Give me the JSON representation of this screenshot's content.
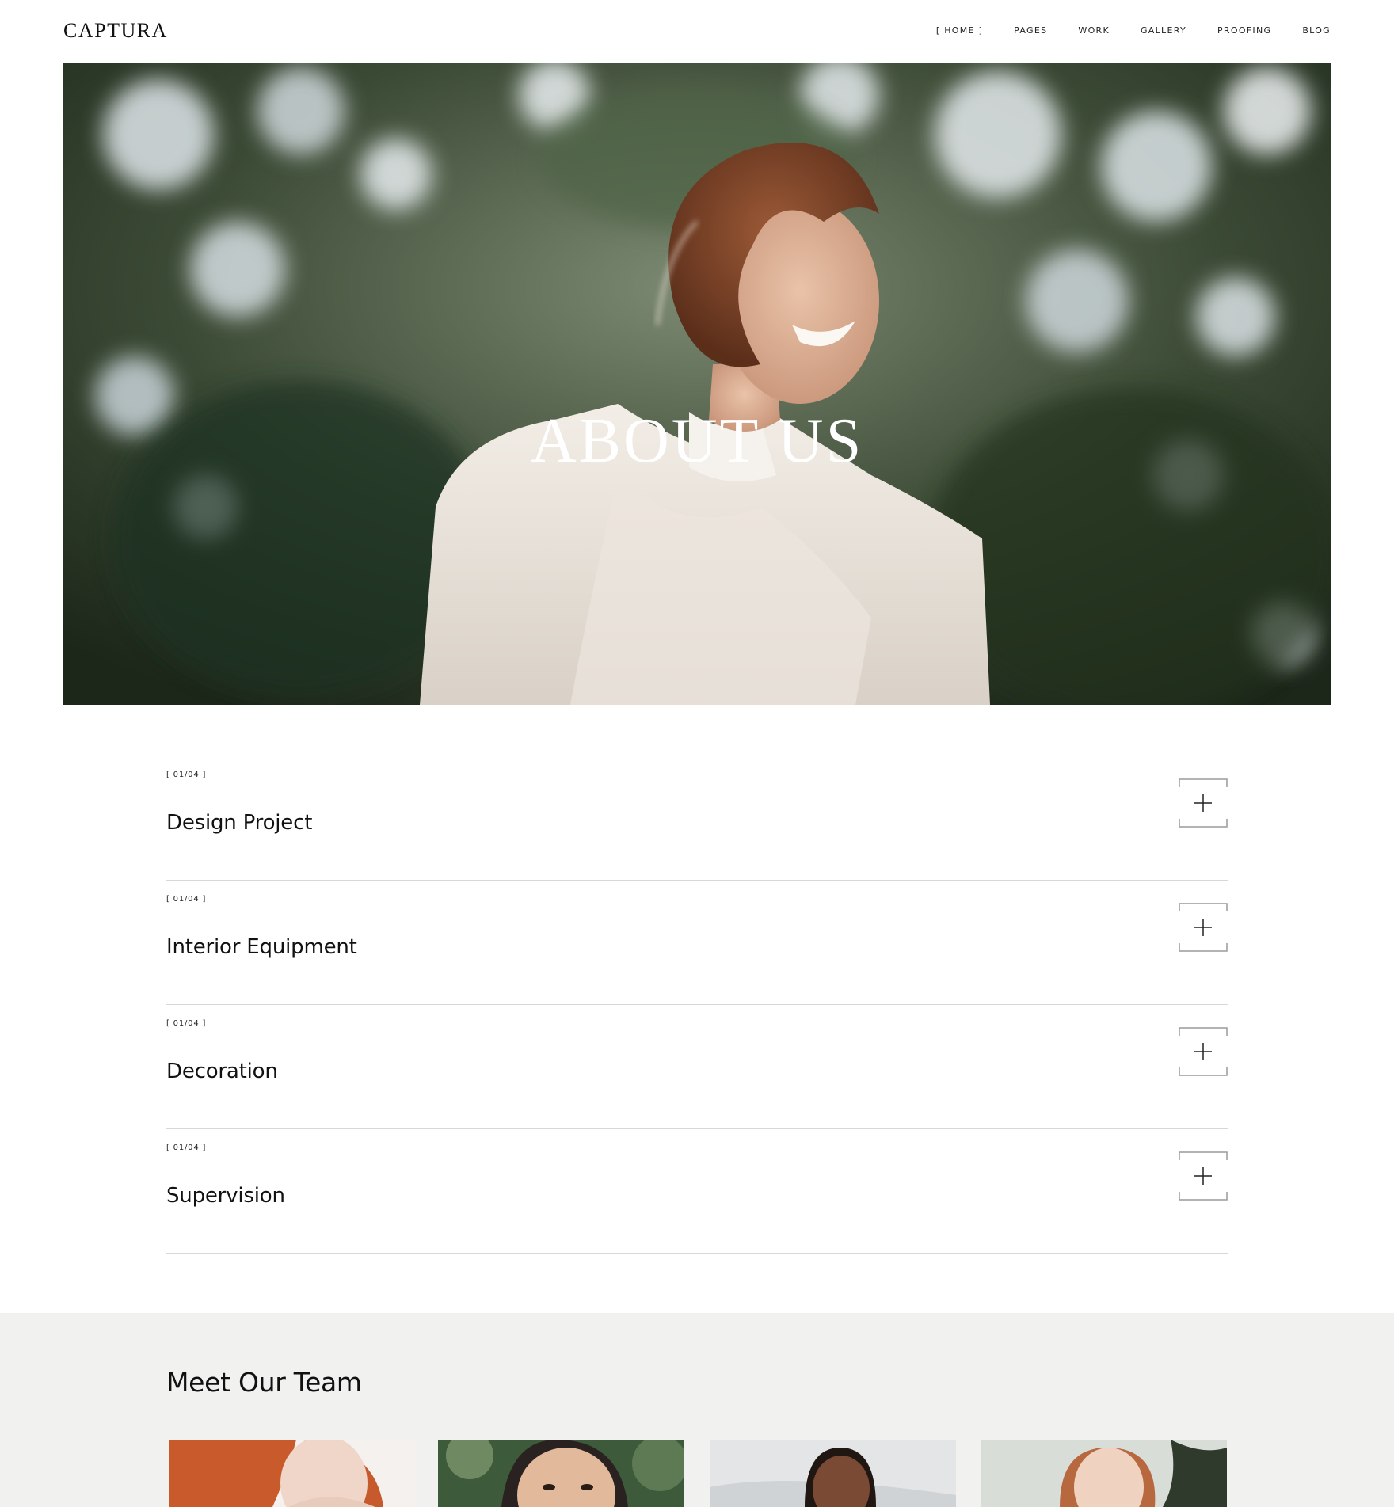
{
  "header": {
    "logo": "CAPTURA",
    "nav": [
      "[ HOME ]",
      "PAGES",
      "WORK",
      "GALLERY",
      "PROOFING",
      "BLOG"
    ]
  },
  "hero": {
    "title": "ABOUT US"
  },
  "accordion": {
    "items": [
      {
        "counter": "[ 01/04 ]",
        "title": "Design Project",
        "toggle_icon": "plus-icon"
      },
      {
        "counter": "[ 01/04 ]",
        "title": "Interior Equipment",
        "toggle_icon": "plus-icon"
      },
      {
        "counter": "[ 01/04 ]",
        "title": "Decoration",
        "toggle_icon": "plus-icon"
      },
      {
        "counter": "[ 01/04 ]",
        "title": "Supervision",
        "toggle_icon": "plus-icon"
      }
    ]
  },
  "team": {
    "title": "Meet Our Team"
  },
  "colors": {
    "text": "#111111",
    "divider": "#d8d8d8",
    "team_bg": "#f1f1f0",
    "hero_title": "#ffffff"
  }
}
